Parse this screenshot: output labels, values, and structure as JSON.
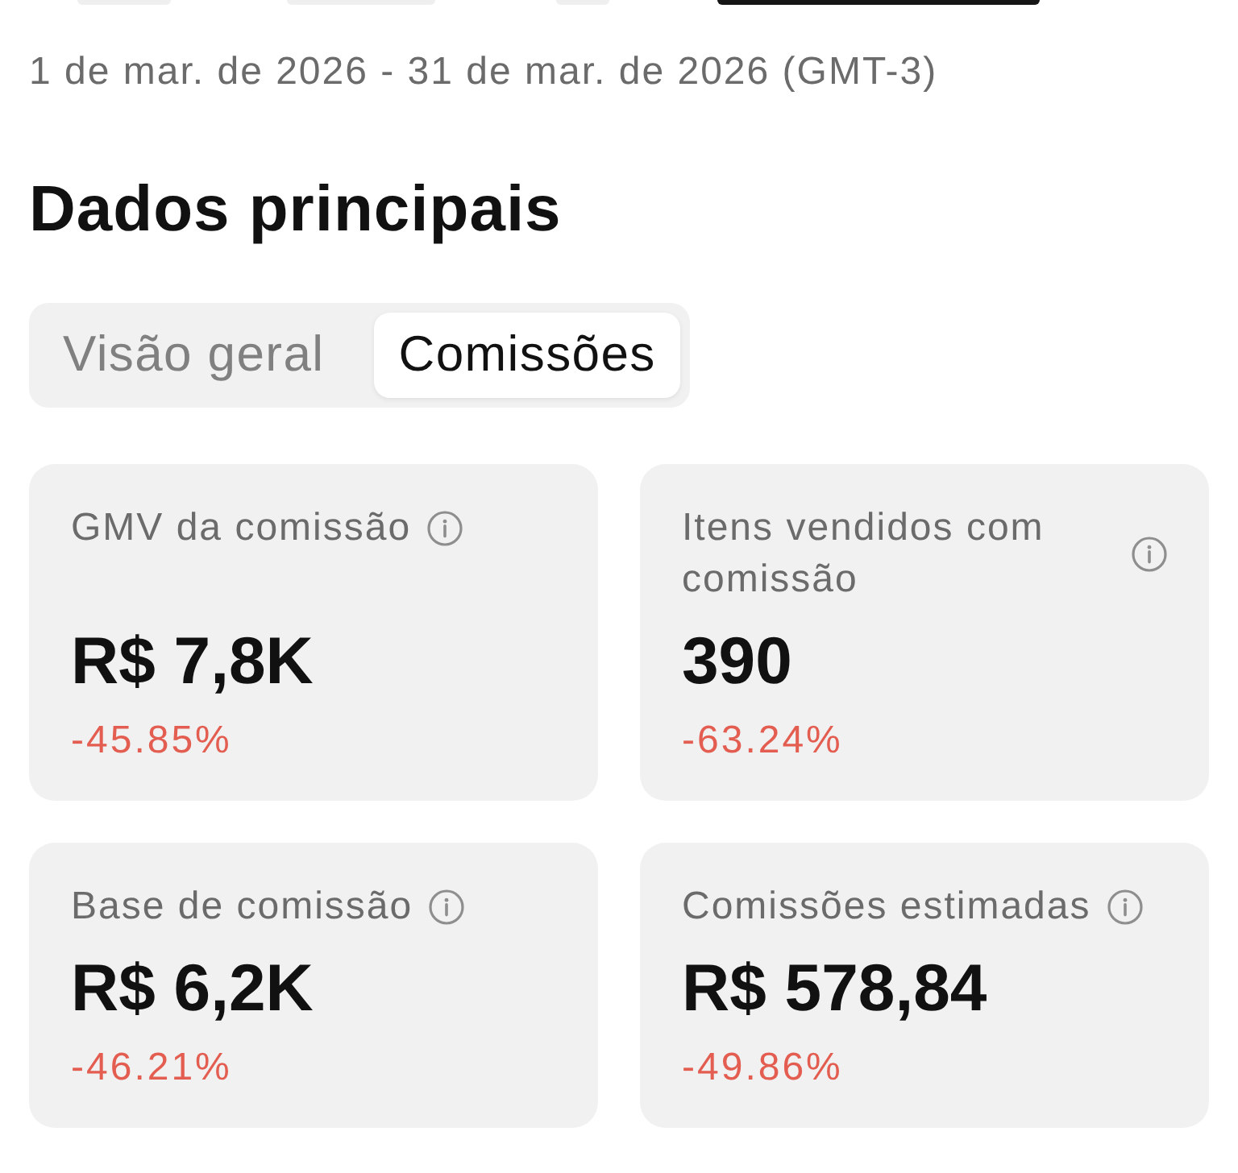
{
  "filter_chips": [
    {
      "selected": false
    },
    {
      "selected": false
    },
    {
      "selected": false
    },
    {
      "selected": true
    }
  ],
  "date_range": "1 de mar. de 2026 - 31 de mar. de 2026 (GMT-3)",
  "section_title": "Dados principais",
  "tabs": [
    {
      "label": "Visão geral",
      "selected": false
    },
    {
      "label": "Comissões",
      "selected": true
    }
  ],
  "metrics": [
    {
      "label": "GMV da comissão",
      "value": "R$ 7,8K",
      "change": "-45.85%",
      "negative": true
    },
    {
      "label": "Itens vendidos com comissão",
      "value": "390",
      "change": "-63.24%",
      "negative": true
    },
    {
      "label": "Base de comissão",
      "value": "R$ 6,2K",
      "change": "-46.21%",
      "negative": true
    },
    {
      "label": "Comissões estimadas",
      "value": "R$ 578,84",
      "change": "-49.86%",
      "negative": true
    }
  ]
}
